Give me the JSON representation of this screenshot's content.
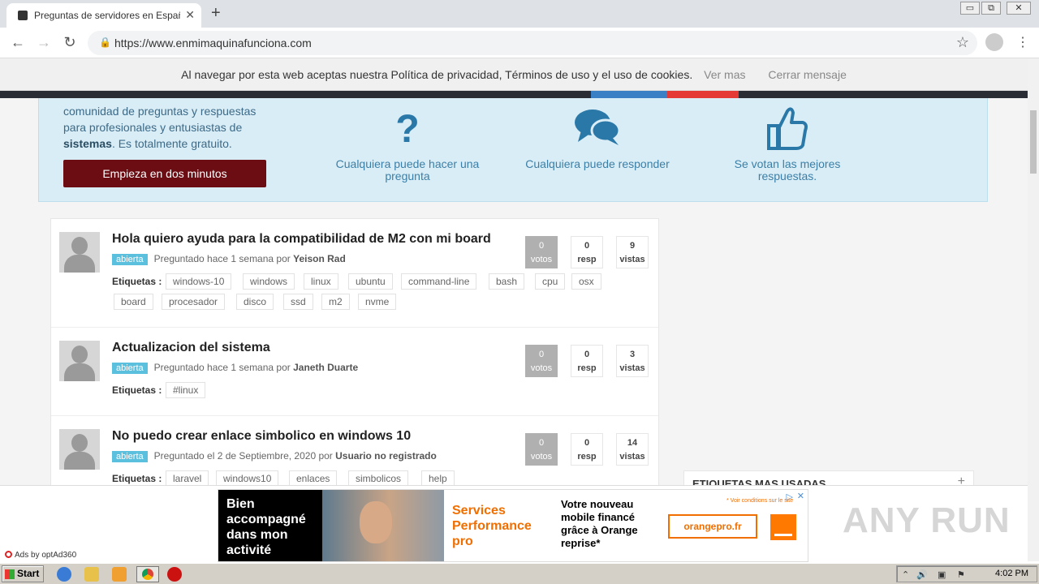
{
  "browser": {
    "tab_title": "Preguntas de servidores en Español",
    "new_tab": "+",
    "url": "https://www.enmimaquinafunciona.com",
    "window_min": "▭",
    "window_max": "⧉",
    "window_close": "✕"
  },
  "cookie_bar": {
    "message": "Al navegar por esta web aceptas nuestra Política de privacidad, Términos de uso y el uso de cookies.",
    "more_link": "Ver mas",
    "close_link": "Cerrar mensaje"
  },
  "hero": {
    "intro_text": "comunidad de preguntas y respuestas para profesionales y entusiastas de",
    "intro_bold": "sistemas",
    "intro_tail": ". Es totalmente gratuito.",
    "cta_label": "Empieza en dos minutos",
    "features": [
      {
        "icon": "question-icon",
        "label": "Cualquiera puede hacer una pregunta"
      },
      {
        "icon": "chat-bubbles-icon",
        "label": "Cualquiera puede responder"
      },
      {
        "icon": "thumbs-up-icon",
        "label": "Se votan las mejores respuestas."
      }
    ]
  },
  "questions": [
    {
      "title": "Hola quiero ayuda para la compatibilidad de M2 con mi board",
      "status": "abierta",
      "asked": "Preguntado hace 1 semana por",
      "user": "Yeison Rad",
      "tags_label": "Etiquetas :",
      "tags": [
        "windows-10",
        "windows",
        "linux",
        "ubuntu",
        "command-line",
        "bash",
        "cpu",
        "osx",
        "board",
        "procesador",
        "disco",
        "ssd",
        "m2",
        "nvme"
      ],
      "votes": "0",
      "votes_label": "votos",
      "answers": "0",
      "answers_label": "resp",
      "views": "9",
      "views_label": "vistas"
    },
    {
      "title": "Actualizacion del sistema",
      "status": "abierta",
      "asked": "Preguntado hace 1 semana por",
      "user": "Janeth Duarte",
      "tags_label": "Etiquetas :",
      "tags": [
        "#linux"
      ],
      "votes": "0",
      "votes_label": "votos",
      "answers": "0",
      "answers_label": "resp",
      "views": "3",
      "views_label": "vistas"
    },
    {
      "title": "No puedo crear enlace simbolico en windows 10",
      "status": "abierta",
      "asked": "Preguntado el 2 de Septiembre, 2020 por",
      "user": "Usuario no registrado",
      "tags_label": "Etiquetas :",
      "tags": [
        "laravel",
        "windows10",
        "enlaces",
        "simbolicos",
        "help"
      ],
      "votes": "0",
      "votes_label": "votos",
      "answers": "0",
      "answers_label": "resp",
      "views": "14",
      "views_label": "vistas"
    }
  ],
  "sidebar": {
    "card_title": "ETIQUETAS MAS USADAS",
    "expand": "+"
  },
  "ad": {
    "by": "Ads by optAd360",
    "headline": "Bien accompagné dans mon activité",
    "brand_line": "Services Performance pro",
    "offer": "Votre nouveau mobile financé grâce à Orange reprise*",
    "button": "orangepro.fr",
    "conditions": "* Voir conditions sur le site",
    "adchoices": "▷",
    "close": "✕",
    "watermark": "ANY RUN"
  },
  "taskbar": {
    "start": "Start",
    "time": "4:02 PM"
  },
  "colors": {
    "hero_bg": "#d9edf7",
    "cta_bg": "#6b0d12",
    "badge": "#5bc0de",
    "orange": "#f16e00"
  }
}
